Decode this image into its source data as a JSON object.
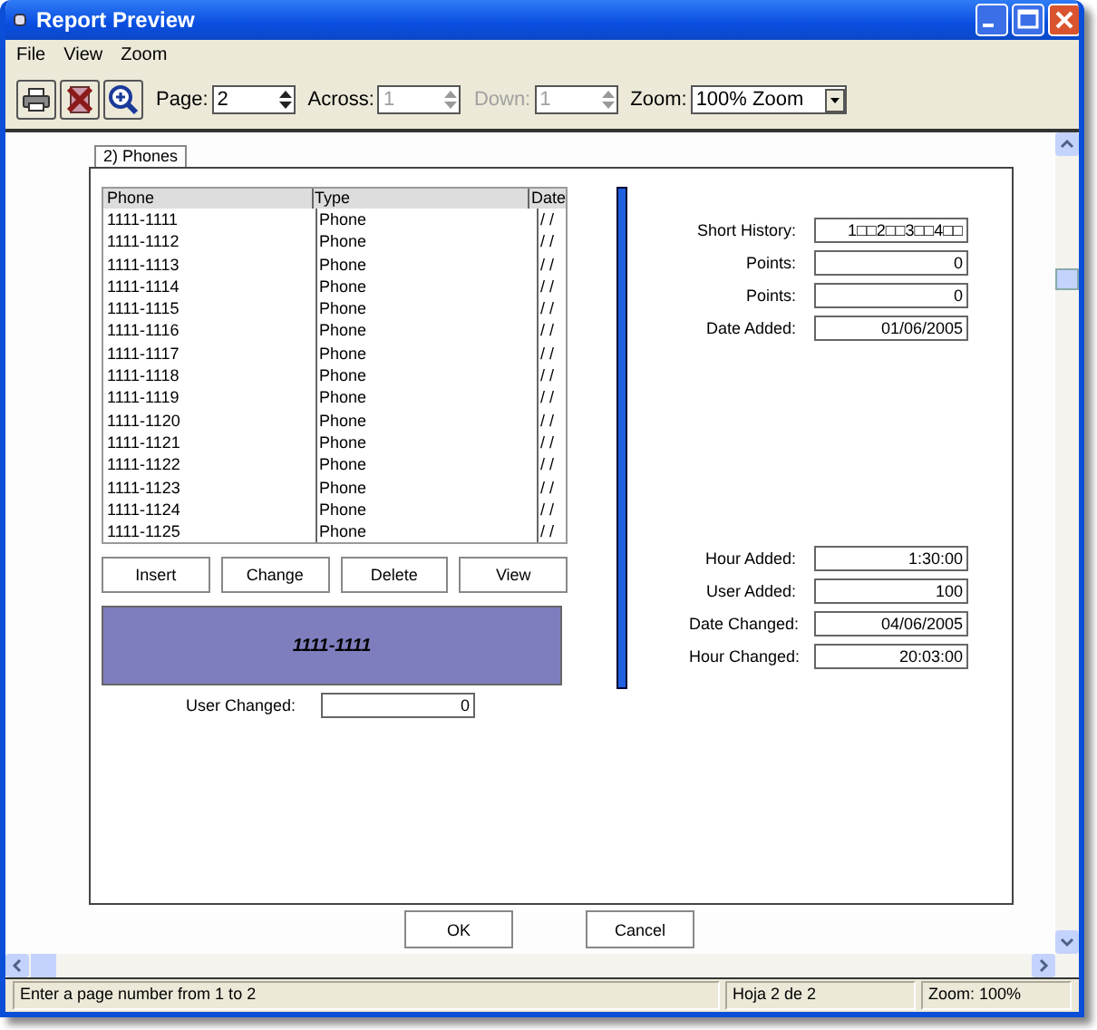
{
  "window": {
    "title": "Report Preview"
  },
  "menu": [
    "File",
    "View",
    "Zoom"
  ],
  "toolbar": {
    "fields": [
      {
        "label": "Page:",
        "value": "2",
        "disabled": false,
        "label_disabled": false
      },
      {
        "label": "Across:",
        "value": "1",
        "disabled": true,
        "label_disabled": false
      },
      {
        "label": "Down:",
        "value": "1",
        "disabled": true,
        "label_disabled": true
      }
    ],
    "zoom": {
      "label": "Zoom:",
      "value": "100% Zoom"
    }
  },
  "report": {
    "tab": "2) Phones",
    "table": {
      "columns": [
        "Phone",
        "Type",
        "Date"
      ],
      "rows": [
        [
          "1111-1111",
          "Phone",
          "/ /"
        ],
        [
          "1111-1112",
          "Phone",
          "/ /"
        ],
        [
          "1111-1113",
          "Phone",
          "/ /"
        ],
        [
          "1111-1114",
          "Phone",
          "/ /"
        ],
        [
          "1111-1115",
          "Phone",
          "/ /"
        ],
        [
          "1111-1116",
          "Phone",
          "/ /"
        ],
        [
          "1111-1117",
          "Phone",
          "/ /"
        ],
        [
          "1111-1118",
          "Phone",
          "/ /"
        ],
        [
          "1111-1119",
          "Phone",
          "/ /"
        ],
        [
          "1111-1120",
          "Phone",
          "/ /"
        ],
        [
          "1111-1121",
          "Phone",
          "/ /"
        ],
        [
          "1111-1122",
          "Phone",
          "/ /"
        ],
        [
          "1111-1123",
          "Phone",
          "/ /"
        ],
        [
          "1111-1124",
          "Phone",
          "/ /"
        ],
        [
          "1111-1125",
          "Phone",
          "/ /"
        ]
      ]
    },
    "buttons": [
      "Insert",
      "Change",
      "Delete",
      "View"
    ],
    "banner": "1111-1111",
    "user_changed": {
      "label": "User Changed:",
      "value": "0"
    },
    "fields_top": [
      {
        "label": "Short History:",
        "value": "1□□2□□3□□4□□"
      },
      {
        "label": "Points:",
        "value": "0"
      },
      {
        "label": "Points:",
        "value": "0"
      },
      {
        "label": "Date Added:",
        "value": "01/06/2005"
      }
    ],
    "fields_bottom": [
      {
        "label": "Hour Added:",
        "value": "1:30:00"
      },
      {
        "label": "User Added:",
        "value": "100"
      },
      {
        "label": "Date Changed:",
        "value": "04/06/2005"
      },
      {
        "label": "Hour Changed:",
        "value": "20:03:00"
      }
    ]
  },
  "dialog_buttons": [
    "OK",
    "Cancel"
  ],
  "status_bar": [
    "Enter a page number from 1 to 2",
    "Hoja 2 de 2",
    "Zoom: 100%"
  ]
}
